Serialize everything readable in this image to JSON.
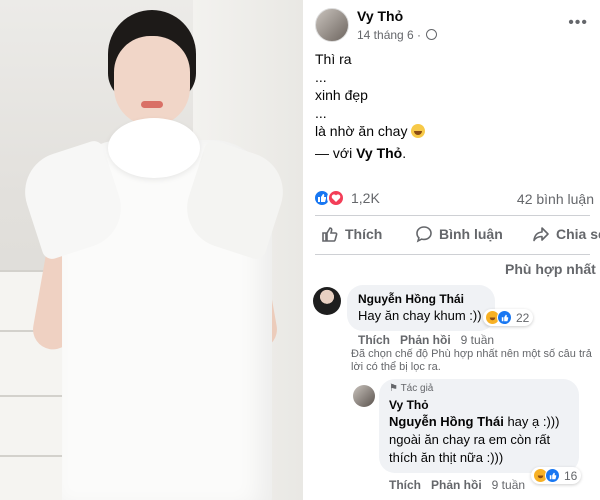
{
  "post": {
    "author": "Vy Thỏ",
    "timestamp": "14 tháng 6 ·",
    "more_label": "•••",
    "lines": [
      "Thì ra",
      "...",
      "xinh đẹp",
      "...",
      "là nhờ ăn chay"
    ],
    "with_prefix": "— với ",
    "with_name": "Vy Thỏ",
    "with_suffix": "."
  },
  "reactions": {
    "count": "1,2K",
    "icons": [
      "like-icon",
      "love-icon"
    ]
  },
  "comments_count": "42 bình luận",
  "actions": {
    "like": "Thích",
    "comment": "Bình luận",
    "share": "Chia sẻ"
  },
  "sort_label": "Phù hợp nhất",
  "comment1": {
    "name": "Nguyễn Hồng Thái",
    "text": "Hay ăn chay khum :))",
    "reaction_count": "22",
    "like": "Thích",
    "reply": "Phản hồi",
    "time": "9 tuần",
    "note": "Đã chọn chế độ Phù hợp nhất nên một số câu trả lời có thể bị lọc ra."
  },
  "comment2": {
    "badge": "Tác giả",
    "name": "Vy Thỏ",
    "mention": "Nguyễn Hồng Thái",
    "line1_rest": " hay ạ :)))",
    "line2": "ngoài ăn chay ra em còn rất",
    "line3": "thích ăn thịt nữa :)))",
    "reaction_count": "16",
    "like": "Thích",
    "reply": "Phản hồi",
    "time": "9 tuần"
  },
  "colors": {
    "link_blue": "#1877f2",
    "love_red": "#f33e58",
    "meta_gray": "#65676b"
  }
}
